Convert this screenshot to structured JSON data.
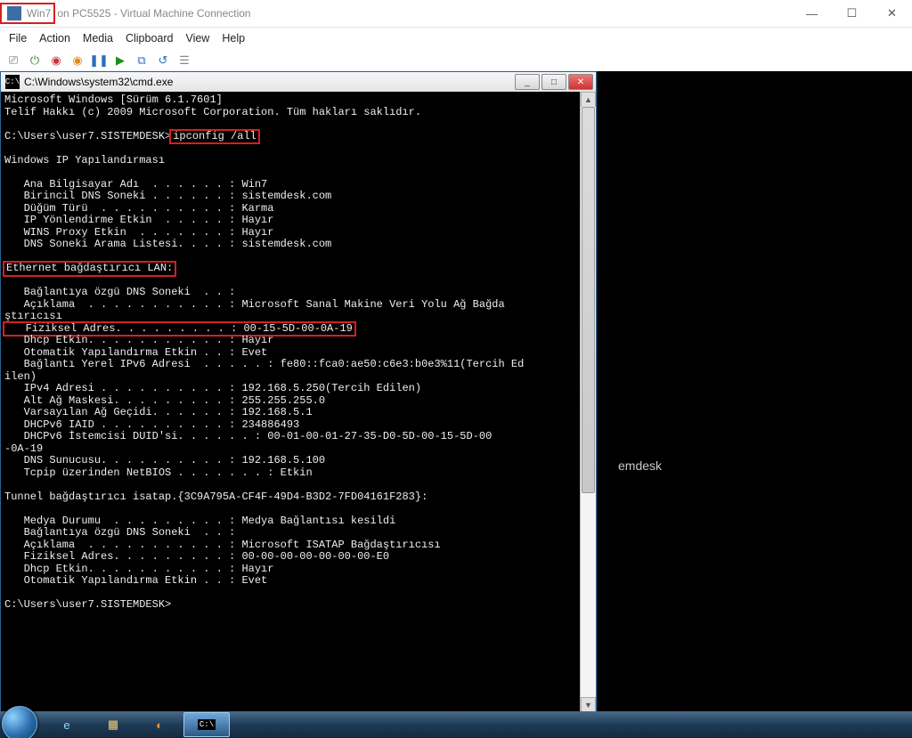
{
  "vmc": {
    "title_highlight_icon": "vm-icon",
    "title_highlight_text": "Win7",
    "title_rest": "on PC5525 - Virtual Machine Connection",
    "menu": [
      "File",
      "Action",
      "Media",
      "Clipboard",
      "View",
      "Help"
    ],
    "toolbar_icons": [
      "ctrl-alt-del-icon",
      "start-icon",
      "turnoff-icon",
      "shutdown-icon",
      "pause-icon",
      "play-icon",
      "checkpoint-icon",
      "revert-icon",
      "share-icon"
    ]
  },
  "cmd": {
    "title": "C:\\Windows\\system32\\cmd.exe",
    "lines": {
      "l1": "Microsoft Windows [Sürüm 6.1.7601]",
      "l2": "Telif Hakkı (c) 2009 Microsoft Corporation. Tüm hakları saklıdır.",
      "l3_prompt": "C:\\Users\\user7.SISTEMDESK>",
      "l3_cmd": "ipconfig /all",
      "l4": "Windows IP Yapılandırması",
      "l5": "   Ana Bilgisayar Adı  . . . . . . : Win7",
      "l6": "   Birincil DNS Soneki . . . . . . : sistemdesk.com",
      "l7": "   Düğüm Türü  . . . . . . . . . . : Karma",
      "l8": "   IP Yönlendirme Etkin  . . . . . : Hayır",
      "l9": "   WINS Proxy Etkin  . . . . . . . : Hayır",
      "l10": "   DNS Soneki Arama Listesi. . . . : sistemdesk.com",
      "l11_hl": "Ethernet bağdaştırıcı LAN:",
      "l12": "   Bağlantıya özgü DNS Soneki  . . :",
      "l13": "   Açıklama  . . . . . . . . . . . : Microsoft Sanal Makine Veri Yolu Ağ Bağda",
      "l13b": "ştırıcısı",
      "l14_hl": "   Fiziksel Adres. . . . . . . . . : 00-15-5D-00-0A-19",
      "l15": "   Dhcp Etkin. . . . . . . . . . . : Hayır",
      "l16": "   Otomatik Yapılandırma Etkin . . : Evet",
      "l17": "   Bağlantı Yerel IPv6 Adresi  . . . . . : fe80::fca0:ae50:c6e3:b0e3%11(Tercih Ed",
      "l17b": "ilen)",
      "l18": "   IPv4 Adresi . . . . . . . . . . : 192.168.5.250(Tercih Edilen)",
      "l19": "   Alt Ağ Maskesi. . . . . . . . . : 255.255.255.0",
      "l20": "   Varsayılan Ağ Geçidi. . . . . . : 192.168.5.1",
      "l21": "   DHCPv6 IAID . . . . . . . . . . : 234886493",
      "l22": "   DHCPv6 İstemcisi DUID'si. . . . . . : 00-01-00-01-27-35-D0-5D-00-15-5D-00",
      "l22b": "-0A-19",
      "l23": "   DNS Sunucusu. . . . . . . . . . : 192.168.5.100",
      "l24": "   Tcpip üzerinden NetBIOS . . . . . . . : Etkin",
      "l25": "Tunnel bağdaştırıcı isatap.{3C9A795A-CF4F-49D4-B3D2-7FD04161F283}:",
      "l26": "   Medya Durumu  . . . . . . . . . : Medya Bağlantısı kesildi",
      "l27": "   Bağlantıya özgü DNS Soneki  . . :",
      "l28": "   Açıklama  . . . . . . . . . . . : Microsoft ISATAP Bağdaştırıcısı",
      "l29": "   Fiziksel Adres. . . . . . . . . : 00-00-00-00-00-00-00-E0",
      "l30": "   Dhcp Etkin. . . . . . . . . . . : Hayır",
      "l31": "   Otomatik Yapılandırma Etkin . . : Evet",
      "l32": "C:\\Users\\user7.SISTEMDESK>"
    }
  },
  "desktop_partial_text": "emdesk",
  "taskbar": {
    "pins": [
      "ie-icon",
      "explorer-icon",
      "wmp-icon",
      "cmd-icon"
    ]
  }
}
